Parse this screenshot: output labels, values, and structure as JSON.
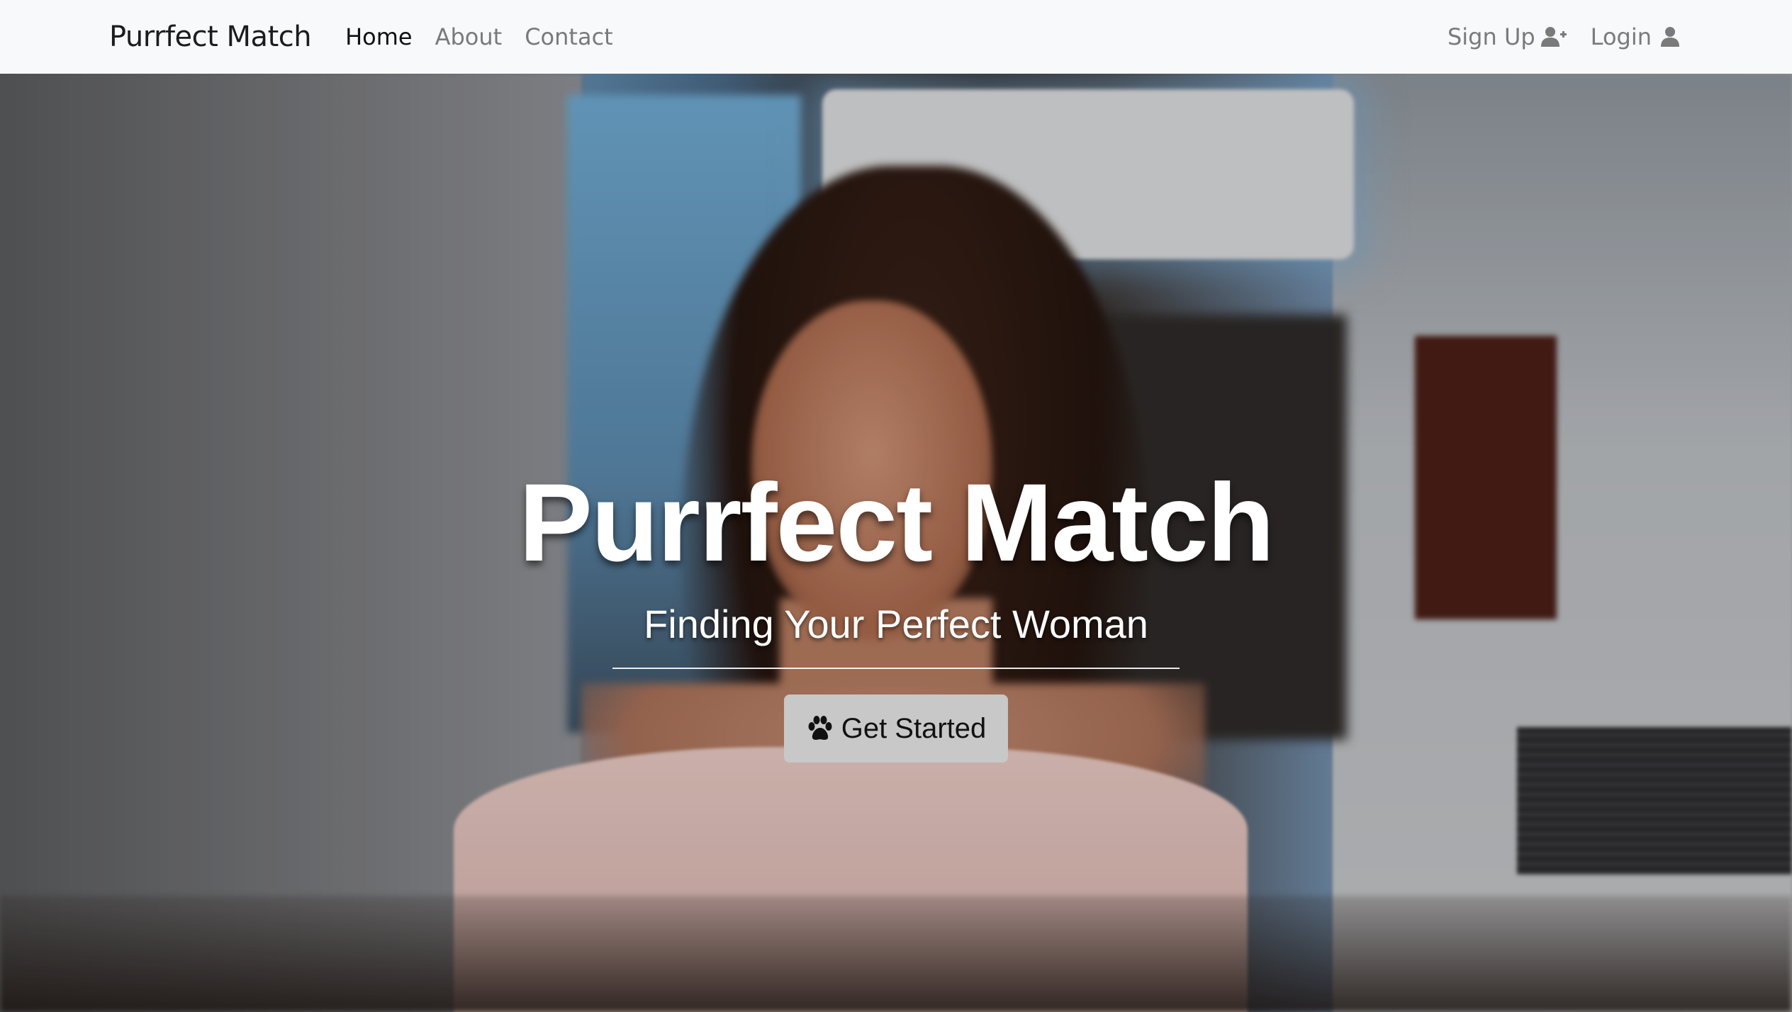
{
  "navbar": {
    "brand": "Purrfect Match",
    "links": [
      {
        "label": "Home",
        "active": true
      },
      {
        "label": "About",
        "active": false
      },
      {
        "label": "Contact",
        "active": false
      }
    ],
    "signup_label": "Sign Up",
    "signup_icon": "user-plus-icon",
    "login_label": "Login",
    "login_icon": "user-icon"
  },
  "hero": {
    "title": "Purrfect Match",
    "subtitle": "Finding Your Perfect Woman",
    "cta_label": "Get Started",
    "cta_icon": "paw-icon"
  },
  "colors": {
    "navbar_bg": "#f8f9fa",
    "nav_link": "#7a7a7a",
    "nav_link_active": "#111111",
    "cta_bg": "#c8c8c8",
    "hero_text": "#ffffff"
  }
}
